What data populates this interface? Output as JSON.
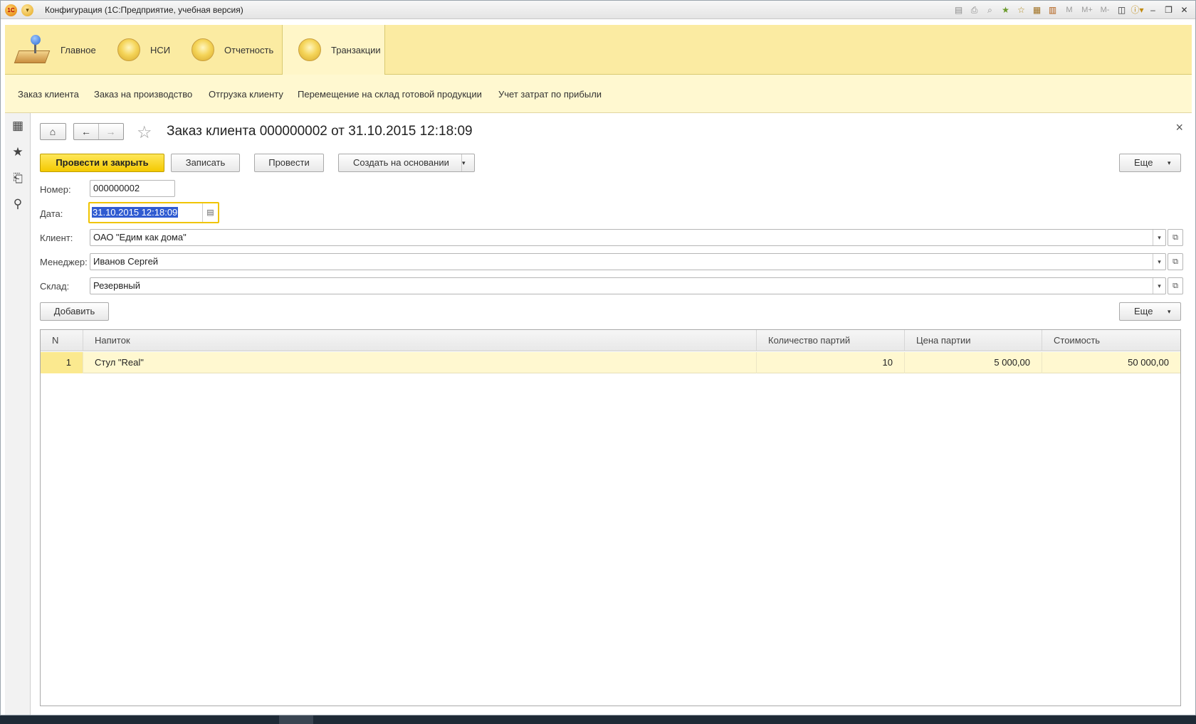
{
  "window": {
    "title": "Конфигурация  (1С:Предприятие, учебная версия)",
    "logo_text": "1С"
  },
  "titlebar_icons": [
    "save-icon",
    "print-icon",
    "preview-icon",
    "favorites-add-icon",
    "favorites-icon",
    "calculator-icon",
    "calendar-icon",
    "M",
    "M+",
    "M-",
    "panels-icon",
    "info-icon",
    "minimize-icon",
    "restore-icon",
    "close-icon"
  ],
  "sections": [
    {
      "label": "Главное"
    },
    {
      "label": "НСИ"
    },
    {
      "label": "Отчетность"
    },
    {
      "label": "Транзакции",
      "active": true
    }
  ],
  "subnav": [
    "Заказ клиента",
    "Заказ на производство",
    "Отгрузка клиенту",
    "Перемещение на склад готовой продукции",
    "Учет затрат по прибыли"
  ],
  "form": {
    "title": "Заказ клиента 000000002 от 31.10.2015 12:18:09",
    "toolbar": {
      "post_close": "Провести и закрыть",
      "save": "Записать",
      "post": "Провести",
      "create_based": "Создать на основании",
      "more": "Еще"
    },
    "fields": {
      "number_label": "Номер:",
      "number_value": "000000002",
      "date_label": "Дата:",
      "date_value": "31.10.2015 12:18:09",
      "client_label": "Клиент:",
      "client_value": "ОАО \"Едим как дома\"",
      "manager_label": "Менеджер:",
      "manager_value": "Иванов Сергей",
      "warehouse_label": "Склад:",
      "warehouse_value": "Резервный"
    },
    "table_toolbar": {
      "add": "Добавить",
      "more": "Еще"
    },
    "table": {
      "columns": [
        "N",
        "Напиток",
        "Количество партий",
        "Цена партии",
        "Стоимость"
      ],
      "rows": [
        [
          "1",
          "Стул \"Real\"",
          "10",
          "5 000,00",
          "50 000,00"
        ]
      ]
    }
  }
}
